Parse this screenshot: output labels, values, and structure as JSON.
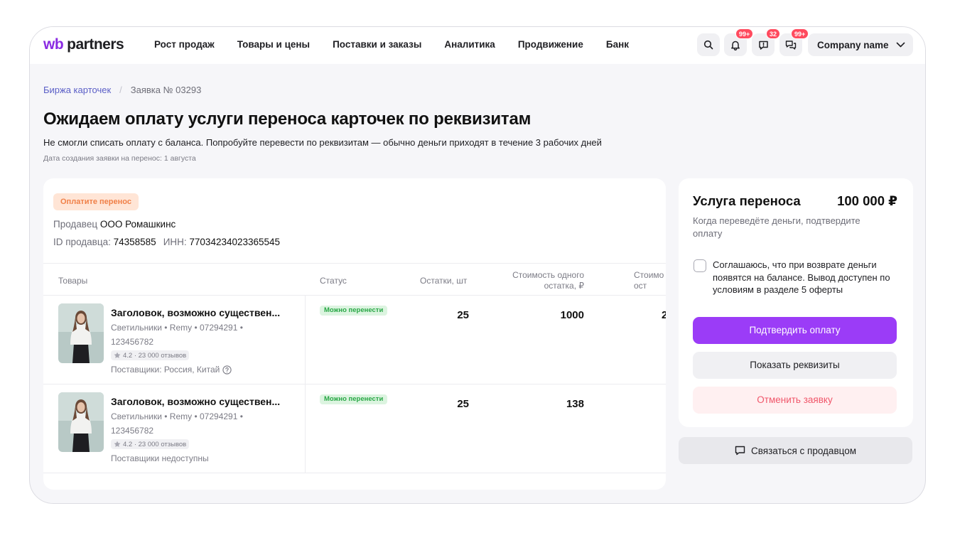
{
  "logo": {
    "wb": "wb",
    "partners": "partners"
  },
  "nav": [
    "Рост продаж",
    "Товары и цены",
    "Поставки и заказы",
    "Аналитика",
    "Продвижение",
    "Банк"
  ],
  "header": {
    "badges": {
      "notifications": "99+",
      "reviews": "32",
      "chats": "99+"
    },
    "company": "Company name"
  },
  "breadcrumb": {
    "parent": "Биржа карточек",
    "separator": "/",
    "current": "Заявка № 03293"
  },
  "page": {
    "title": "Ожидаем оплату услуги переноса карточек по реквизитам",
    "subtitle": "Не смогли списать оплату с баланса. Попробуйте перевести по реквизитам — обычно деньги приходят в течение 3 рабочих дней",
    "created": "Дата создания заявки на перенос: 1 августа"
  },
  "seller": {
    "status_pill": "Оплатите перенос",
    "seller_label": "Продавец",
    "seller_name": "ООО Ромашкинс",
    "id_label": "ID продавца:",
    "id_value": "74358585",
    "inn_label": "ИНН:",
    "inn_value": "77034234023365545"
  },
  "table": {
    "headers": {
      "goods": "Товары",
      "status": "Статус",
      "stock": "Остатки, шт",
      "price_line1": "Стоимость одного",
      "price_line2": "остатка, ₽",
      "cost_line1": "Стоимо",
      "cost_line2": "ост"
    },
    "rows": [
      {
        "title": "Заголовок, возможно существен...",
        "meta1": "Светильники • Remy • 07294291 •",
        "meta2": "123456782",
        "rating": "4.2 · 23 000 отзывов",
        "suppliers": "Поставщики: Россия, Китай",
        "status": "Можно перенести",
        "stock": "25",
        "price": "1000",
        "cost": "2"
      },
      {
        "title": "Заголовок, возможно существен...",
        "meta1": "Светильники • Remy • 07294291 •",
        "meta2": "123456782",
        "rating": "4.2 · 23 000 отзывов",
        "suppliers": "Поставщики недоступны",
        "status": "Можно перенести",
        "stock": "25",
        "price": "138",
        "cost": ""
      }
    ]
  },
  "service": {
    "title": "Услуга переноса",
    "price": "100 000 ₽",
    "description": "Когда переведёте деньги, подтвердите оплату",
    "agreement": "Соглашаюсь, что при возврате деньги появятся на балансе. Вывод доступен по условиям в разделе 5 оферты",
    "confirm": "Подтвердить оплату",
    "details": "Показать реквизиты",
    "cancel": "Отменить заявку"
  },
  "contact_seller": "Связаться с продавцом",
  "colors": {
    "accent": "#9b3cf7",
    "link": "#5b5fc7",
    "badge": "#ff4a5e",
    "ok": "#28a745",
    "warn": "#f08048"
  }
}
